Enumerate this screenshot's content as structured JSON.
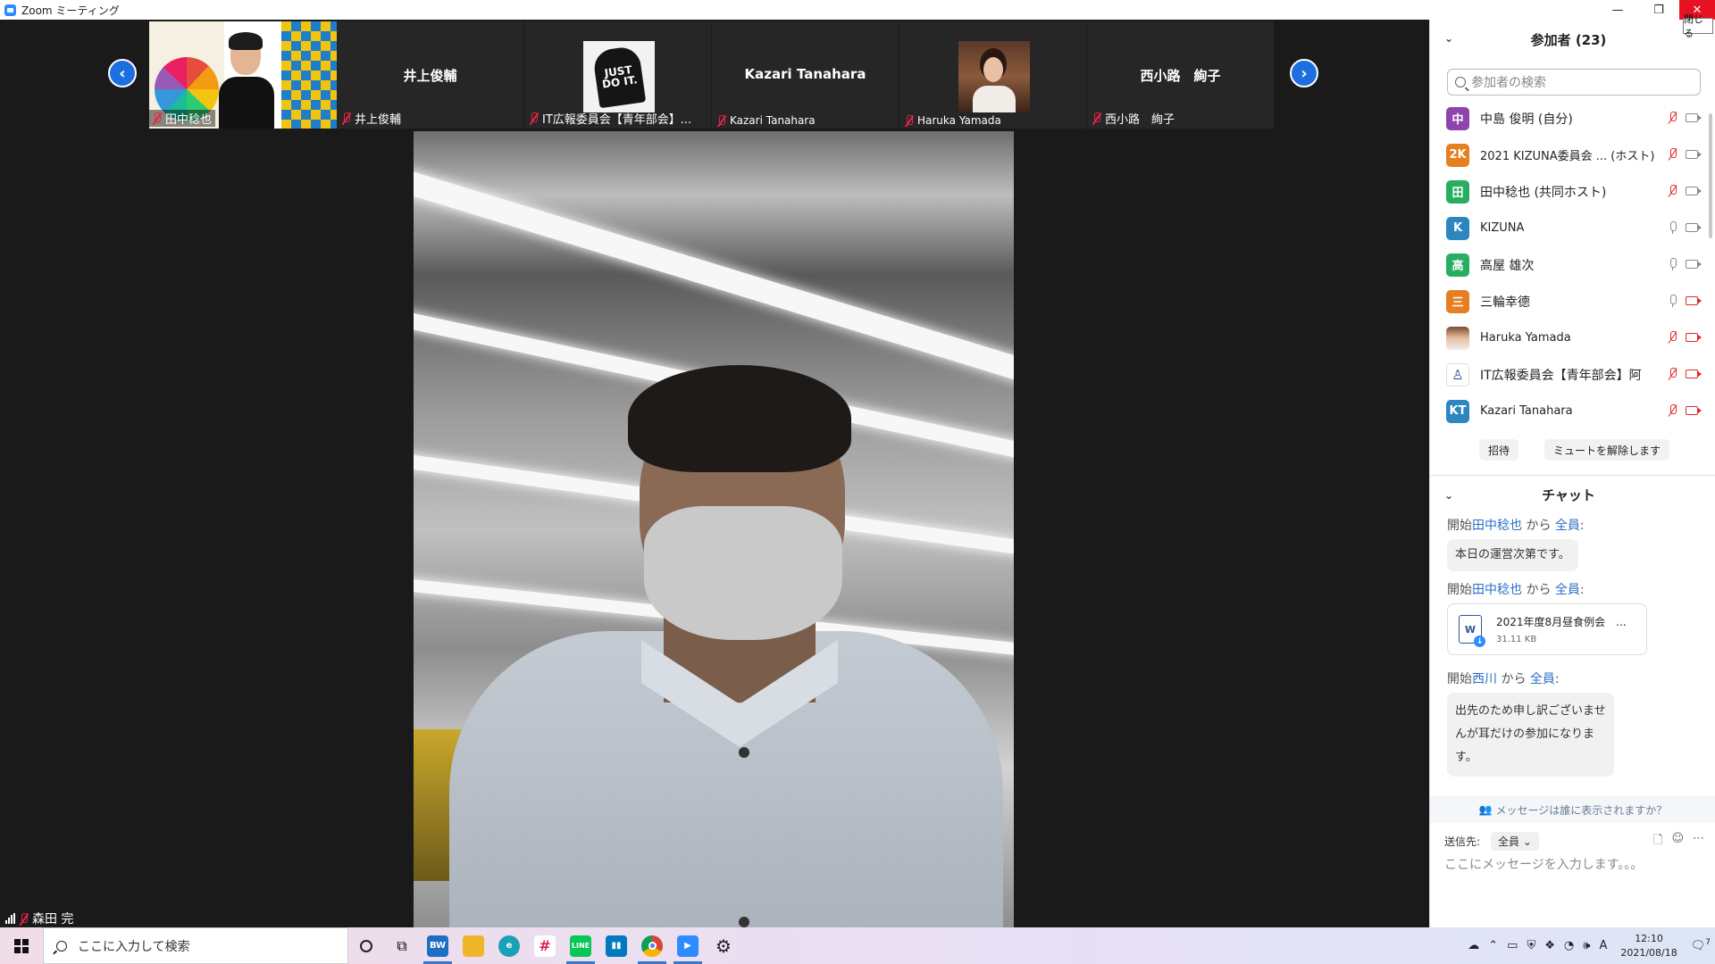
{
  "window": {
    "title": "Zoom ミーティング",
    "close_tooltip": "閉じる"
  },
  "strip": {
    "tiles": [
      {
        "label": "田中稔也",
        "big_name": ""
      },
      {
        "label": "井上俊輔",
        "big_name": "井上俊輔"
      },
      {
        "label": "IT広報委員会【青年部会】...",
        "big_name": ""
      },
      {
        "label": "Kazari Tanahara",
        "big_name": "Kazari Tanahara"
      },
      {
        "label": "Haruka Yamada",
        "big_name": ""
      },
      {
        "label": "西小路　絢子",
        "big_name": "西小路　絢子"
      }
    ],
    "jdi_text": "JUST DO IT."
  },
  "main_video": {
    "speaker_name": "森田 完"
  },
  "participants_panel": {
    "title": "参加者 (23)",
    "search_placeholder": "参加者の検索",
    "items": [
      {
        "avatar": "中",
        "color": "#8e44ad",
        "name": "中島 俊明 (自分)",
        "mic": "off",
        "cam": "on"
      },
      {
        "avatar": "2K",
        "color": "#e67e22",
        "name": "2021 KIZUNA委員会 ... (ホスト)",
        "mic": "off",
        "cam": "on"
      },
      {
        "avatar": "田",
        "color": "#27ae60",
        "name": "田中稔也 (共同ホスト)",
        "mic": "off",
        "cam": "on"
      },
      {
        "avatar": "K",
        "color": "#2e86c1",
        "name": "KIZUNA",
        "mic": "on",
        "cam": "on"
      },
      {
        "avatar": "高",
        "color": "#27ae60",
        "name": "高屋 雄次",
        "mic": "on",
        "cam": "on"
      },
      {
        "avatar": "三",
        "color": "#e67e22",
        "name": "三輪幸德",
        "mic": "on",
        "cam": "off"
      },
      {
        "avatar": "",
        "color": "#7b4a2e",
        "name": "Haruka Yamada",
        "mic": "off",
        "cam": "off"
      },
      {
        "avatar": "♙",
        "color": "#ffffff",
        "name": "IT広報委員会【青年部会】阿",
        "mic": "off",
        "cam": "off"
      },
      {
        "avatar": "KT",
        "color": "#2e86c1",
        "name": "Kazari Tanahara",
        "mic": "off",
        "cam": "off"
      }
    ],
    "invite_label": "招待",
    "unmute_label": "ミュートを解除します"
  },
  "chat_panel": {
    "title": "チャット",
    "messages": [
      {
        "prefix": "開始",
        "sender": "田中稔也",
        "mid": " から ",
        "target": "全員",
        "suffix": ":",
        "text": "本日の運営次第です。"
      },
      {
        "prefix": "開始",
        "sender": "田中稔也",
        "mid": " から ",
        "target": "全員",
        "suffix": ":",
        "file_icon": "W",
        "file_name": "2021年度8月昼食例会　...",
        "file_size": "31.11 KB"
      },
      {
        "prefix": "開始",
        "sender": "西川",
        "mid": " から ",
        "target": "全員",
        "suffix": ":",
        "text_lines": [
          "出先のため申し訳ございませ",
          "んが耳だけの参加になりま",
          "す。"
        ]
      }
    ],
    "visibility_note": "メッセージは誰に表示されますか？",
    "send_to_label": "送信先:",
    "send_to_value": "全員",
    "input_placeholder": "ここにメッセージを入力します。。。"
  },
  "taskbar": {
    "search_placeholder": "ここに入力して検索",
    "time": "12:10",
    "date": "2021/08/18",
    "ime": "A",
    "notif_count": "7",
    "apps": [
      {
        "name": "task-view",
        "glyph": "O",
        "color": "transparent"
      },
      {
        "name": "multitask",
        "glyph": "⊞",
        "color": "transparent"
      },
      {
        "name": "bw",
        "glyph": "BW",
        "color": "#1e6fc4"
      },
      {
        "name": "explorer",
        "glyph": "▬",
        "color": "#f0b429"
      },
      {
        "name": "edge",
        "glyph": "e",
        "color": "#1aa1b8"
      },
      {
        "name": "slack",
        "glyph": "#",
        "color": "#e01e5a"
      },
      {
        "name": "line",
        "glyph": "LINE",
        "color": "#06c755"
      },
      {
        "name": "trello",
        "glyph": "▮▮",
        "color": "#0079bf"
      },
      {
        "name": "chrome",
        "glyph": "●",
        "color": "#db4437"
      },
      {
        "name": "zoom",
        "glyph": "▶",
        "color": "#2d8cff"
      },
      {
        "name": "settings",
        "glyph": "⚙",
        "color": "transparent"
      }
    ]
  }
}
